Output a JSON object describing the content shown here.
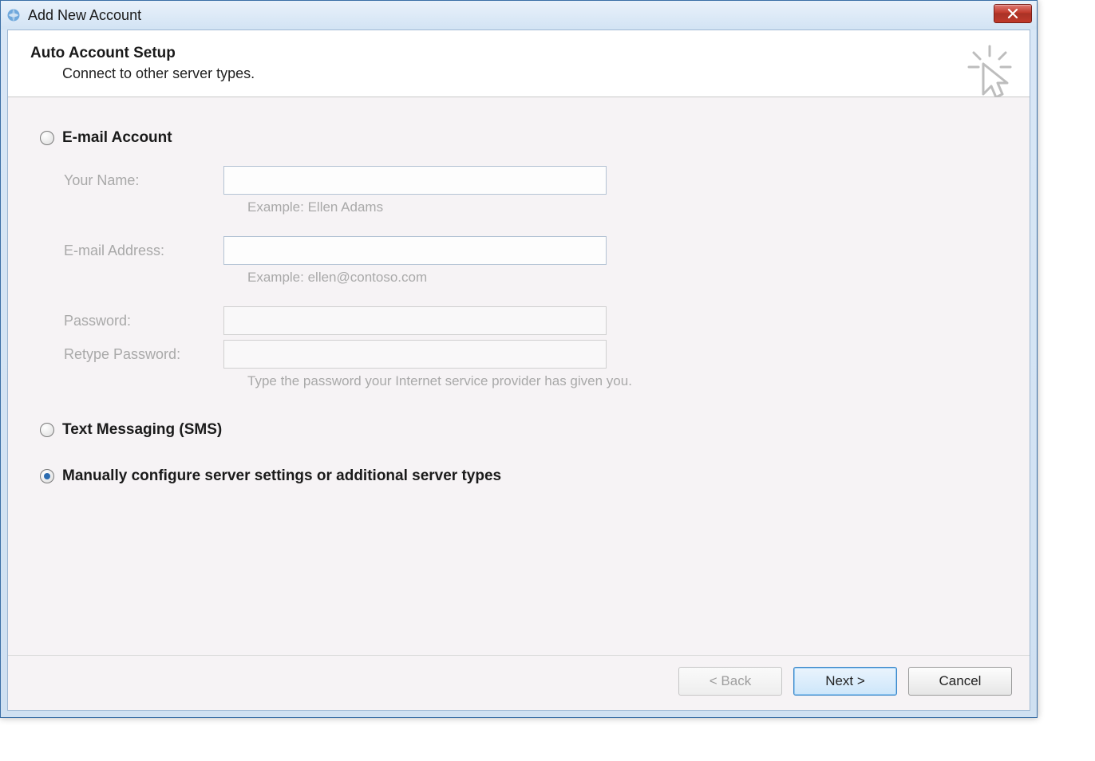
{
  "window": {
    "title": "Add New Account"
  },
  "header": {
    "title": "Auto Account Setup",
    "subtitle": "Connect to other server types."
  },
  "options": {
    "email": {
      "label": "E-mail Account",
      "selected": false
    },
    "sms": {
      "label": "Text Messaging (SMS)",
      "selected": false
    },
    "manual": {
      "label": "Manually configure server settings or additional server types",
      "selected": true
    }
  },
  "form": {
    "name": {
      "label": "Your Name:",
      "value": "",
      "hint": "Example: Ellen Adams"
    },
    "email": {
      "label": "E-mail Address:",
      "value": "",
      "hint": "Example: ellen@contoso.com"
    },
    "password": {
      "label": "Password:",
      "value": ""
    },
    "retype": {
      "label": "Retype Password:",
      "value": "",
      "hint": "Type the password your Internet service provider has given you."
    }
  },
  "buttons": {
    "back": "< Back",
    "next": "Next >",
    "cancel": "Cancel"
  }
}
